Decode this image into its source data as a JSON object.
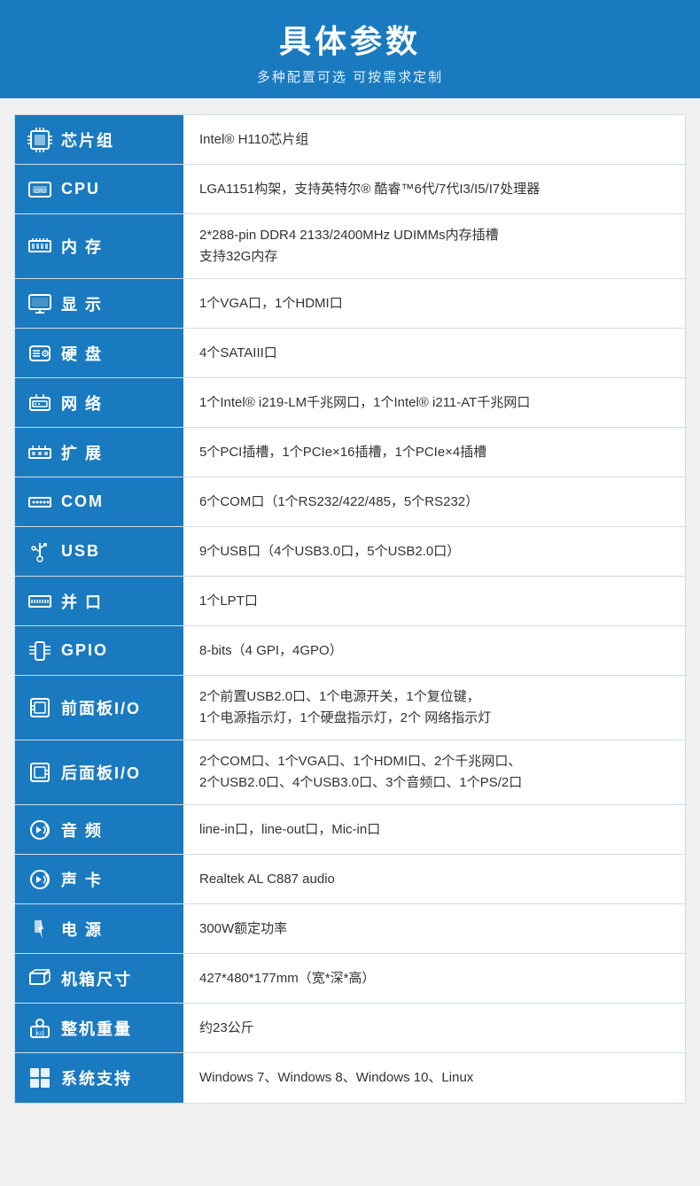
{
  "header": {
    "title": "具体参数",
    "subtitle": "多种配置可选 可按需求定制"
  },
  "rows": [
    {
      "id": "chipset",
      "icon": "chipset-icon",
      "icon_symbol": "⬛",
      "label": "芯片组",
      "value": "Intel® H110芯片组"
    },
    {
      "id": "cpu",
      "icon": "cpu-icon",
      "icon_symbol": "🖥",
      "label": "CPU",
      "value": "LGA1151构架，支持英特尔® 酷睿™6代/7代I3/I5/I7处理器"
    },
    {
      "id": "memory",
      "icon": "memory-icon",
      "icon_symbol": "▦",
      "label": "内 存",
      "value": "2*288-pin DDR4 2133/2400MHz UDIMMs内存插槽\n支持32G内存"
    },
    {
      "id": "display",
      "icon": "display-icon",
      "icon_symbol": "🖵",
      "label": "显 示",
      "value": "1个VGA口，1个HDMI口"
    },
    {
      "id": "harddisk",
      "icon": "harddisk-icon",
      "icon_symbol": "💾",
      "label": "硬 盘",
      "value": "4个SATAIII口"
    },
    {
      "id": "network",
      "icon": "network-icon",
      "icon_symbol": "🖧",
      "label": "网 络",
      "value": "1个Intel® i219-LM千兆网口，1个Intel® i211-AT千兆网口"
    },
    {
      "id": "expansion",
      "icon": "expansion-icon",
      "icon_symbol": "▪",
      "label": "扩 展",
      "value": "5个PCI插槽，1个PCIe×16插槽，1个PCIe×4插槽"
    },
    {
      "id": "com",
      "icon": "com-icon",
      "icon_symbol": "≡",
      "label": "COM",
      "value": "6个COM口（1个RS232/422/485，5个RS232）"
    },
    {
      "id": "usb",
      "icon": "usb-icon",
      "icon_symbol": "⇌",
      "label": "USB",
      "value": "9个USB口（4个USB3.0口，5个USB2.0口）"
    },
    {
      "id": "parallel",
      "icon": "parallel-icon",
      "icon_symbol": "⊟",
      "label": "并 口",
      "value": "1个LPT口"
    },
    {
      "id": "gpio",
      "icon": "gpio-icon",
      "icon_symbol": "⊞",
      "label": "GPIO",
      "value": "8-bits（4 GPI，4GPO）"
    },
    {
      "id": "front-panel",
      "icon": "front-panel-icon",
      "icon_symbol": "▣",
      "label": "前面板I/O",
      "value": "2个前置USB2.0口、1个电源开关，1个复位键，\n1个电源指示灯，1个硬盘指示灯，2个 网络指示灯"
    },
    {
      "id": "rear-panel",
      "icon": "rear-panel-icon",
      "icon_symbol": "▣",
      "label": "后面板I/O",
      "value": "2个COM口、1个VGA口、1个HDMI口、2个千兆网口、\n2个USB2.0口、4个USB3.0口、3个音频口、1个PS/2口"
    },
    {
      "id": "audio",
      "icon": "audio-icon",
      "icon_symbol": "🔊",
      "label": "音 频",
      "value": "line-in口，line-out口，Mic-in口"
    },
    {
      "id": "soundcard",
      "icon": "soundcard-icon",
      "icon_symbol": "🔊",
      "label": "声 卡",
      "value": "Realtek AL C887 audio"
    },
    {
      "id": "power",
      "icon": "power-icon",
      "icon_symbol": "⚡",
      "label": "电 源",
      "value": "300W额定功率"
    },
    {
      "id": "dimension",
      "icon": "dimension-icon",
      "icon_symbol": "✂",
      "label": "机箱尺寸",
      "value": "427*480*177mm（宽*深*高）"
    },
    {
      "id": "weight",
      "icon": "weight-icon",
      "icon_symbol": "⚖",
      "label": "整机重量",
      "value": "约23公斤"
    },
    {
      "id": "os",
      "icon": "os-icon",
      "icon_symbol": "⊞",
      "label": "系统支持",
      "value": "Windows 7、Windows 8、Windows 10、Linux"
    }
  ],
  "colors": {
    "accent": "#1a7abf",
    "border": "#cde",
    "text": "#333",
    "header_text": "#fff"
  }
}
